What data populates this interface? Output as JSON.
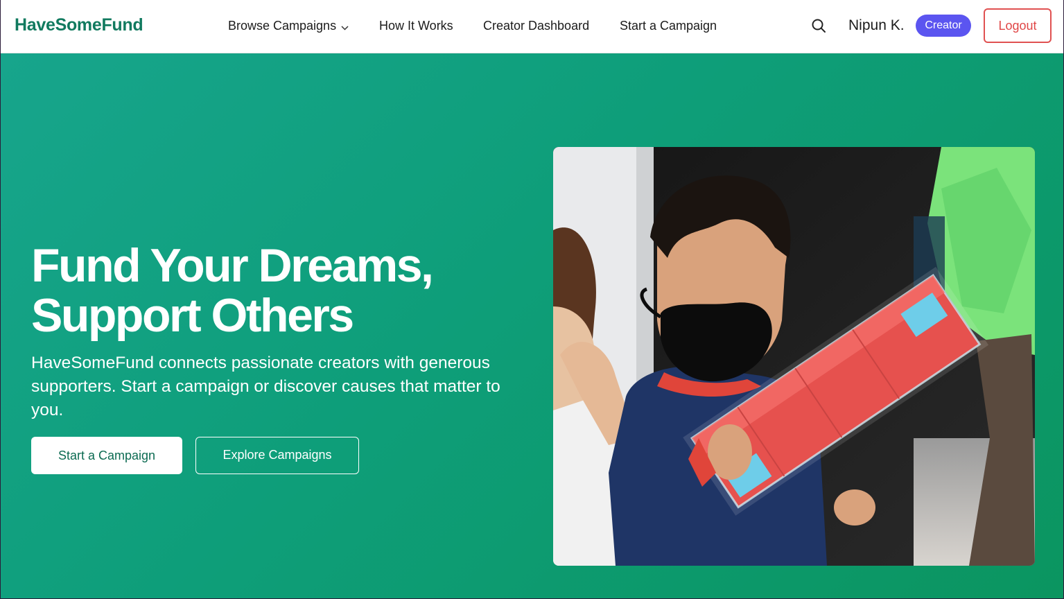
{
  "brand": "HaveSomeFund",
  "nav": {
    "browse": "Browse Campaigns",
    "how": "How It Works",
    "dashboard": "Creator Dashboard",
    "start": "Start a Campaign"
  },
  "user": {
    "name": "Nipun K.",
    "role_badge": "Creator",
    "logout": "Logout"
  },
  "hero": {
    "headline_line1": "Fund Your Dreams,",
    "headline_line2": "Support Others",
    "subtext": "HaveSomeFund connects passionate creators with generous supporters. Start a campaign or discover causes that matter to you.",
    "primary_cta": "Start a Campaign",
    "secondary_cta": "Explore Campaigns",
    "image_icon": "child-with-gift-photo"
  },
  "colors": {
    "brand": "#117a5f",
    "hero_gradient_start": "#17a58c",
    "hero_gradient_end": "#0b9560",
    "badge": "#5b55f0",
    "logout": "#e04646"
  }
}
